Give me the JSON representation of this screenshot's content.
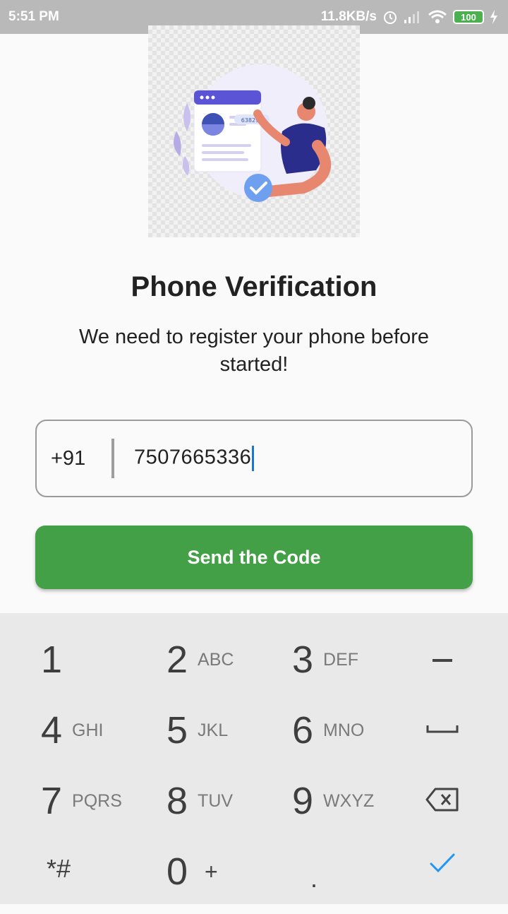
{
  "status_bar": {
    "time": "5:51 PM",
    "net_speed": "11.8KB/s",
    "battery": "100"
  },
  "illustration": {
    "code_text": "638290"
  },
  "title": "Phone Verification",
  "subtitle": "We need to register your phone before started!",
  "phone_field": {
    "country_code": "+91",
    "value": "7507665336"
  },
  "send_button": {
    "label": "Send the Code"
  },
  "keypad": {
    "keys": [
      {
        "num": "1",
        "letters": ""
      },
      {
        "num": "2",
        "letters": "ABC"
      },
      {
        "num": "3",
        "letters": "DEF"
      },
      {
        "num": "4",
        "letters": "GHI"
      },
      {
        "num": "5",
        "letters": "JKL"
      },
      {
        "num": "6",
        "letters": "MNO"
      },
      {
        "num": "7",
        "letters": "PQRS"
      },
      {
        "num": "8",
        "letters": "TUV"
      },
      {
        "num": "9",
        "letters": "WXYZ"
      },
      {
        "num": "*#",
        "letters": ""
      },
      {
        "num": "0",
        "letters": "+"
      },
      {
        "num": ".",
        "letters": ""
      }
    ],
    "icons": {
      "minus": "minus-icon",
      "space": "space-icon",
      "backspace": "backspace-icon",
      "done": "check-icon"
    }
  },
  "colors": {
    "accent_green": "#43a047",
    "caret_blue": "#1976d2",
    "status_bar": "#b9b9b9"
  }
}
